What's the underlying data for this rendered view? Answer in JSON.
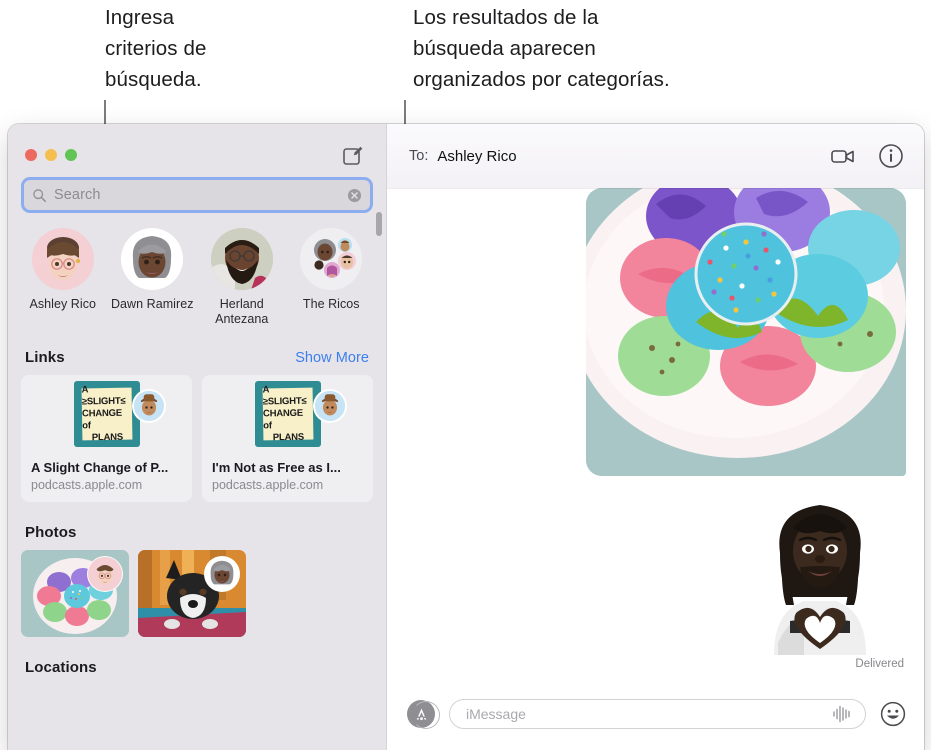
{
  "annotations": {
    "left_callout": "Ingresa\ncriterios de\nbúsqueda.",
    "right_callout": "Los resultados de la\nbúsqueda aparecen\norganizados por categorías."
  },
  "window": {
    "traffic_lights": [
      "close-red",
      "minimize-yellow",
      "zoom-green"
    ],
    "compose_icon": "compose-icon"
  },
  "sidebar": {
    "search": {
      "icon": "search-icon",
      "placeholder": "Search",
      "value": "",
      "clear_icon": "clear-icon"
    },
    "contacts": [
      {
        "name": "Ashley Rico",
        "avatar": "memoji-ashley"
      },
      {
        "name": "Dawn Ramirez",
        "avatar": "memoji-dawn"
      },
      {
        "name": "Herland Antezana",
        "avatar": "photo-herland"
      },
      {
        "name": "The Ricos",
        "avatar": "group-the-ricos"
      }
    ],
    "sections": {
      "links": {
        "title": "Links",
        "show_more": "Show More",
        "items": [
          {
            "title": "A Slight Change of P...",
            "domain": "podcasts.apple.com",
            "artwork_text": [
              "A ≥SLIGHT≤",
              "CHANGE of",
              "PLANS"
            ],
            "badge": "memoji-hat"
          },
          {
            "title": "I'm Not as Free as I...",
            "domain": "podcasts.apple.com",
            "artwork_text": [
              "A ≥SLIGHT≤",
              "CHANGE of",
              "PLANS"
            ],
            "badge": "memoji-hat"
          }
        ]
      },
      "photos": {
        "title": "Photos",
        "items": [
          {
            "alt": "macarons-on-plate",
            "badge": "memoji-ashley"
          },
          {
            "alt": "french-bulldog",
            "badge": "memoji-dawn"
          }
        ]
      },
      "locations": {
        "title": "Locations"
      }
    }
  },
  "conversation": {
    "to_label": "To:",
    "recipient": "Ashley Rico",
    "video_icon": "video-call-icon",
    "info_icon": "info-icon",
    "messages": [
      {
        "type": "image",
        "alt": "macarons-on-plate"
      },
      {
        "type": "sticker",
        "alt": "memoji-heart-hands"
      }
    ],
    "status": "Delivered",
    "compose": {
      "appstore_icon": "app-store-icon",
      "placeholder": "iMessage",
      "value": "",
      "audio_icon": "audio-waveform-icon",
      "emoji_icon": "emoji-smiley-icon"
    }
  },
  "colors": {
    "accent_blue": "#3b7ff0",
    "focus_ring": "#8caef0",
    "sidebar_bg": "#e6e4e8",
    "traffic_red": "#ec6a5e",
    "traffic_yellow": "#f4bf4f",
    "traffic_green": "#61c454"
  }
}
